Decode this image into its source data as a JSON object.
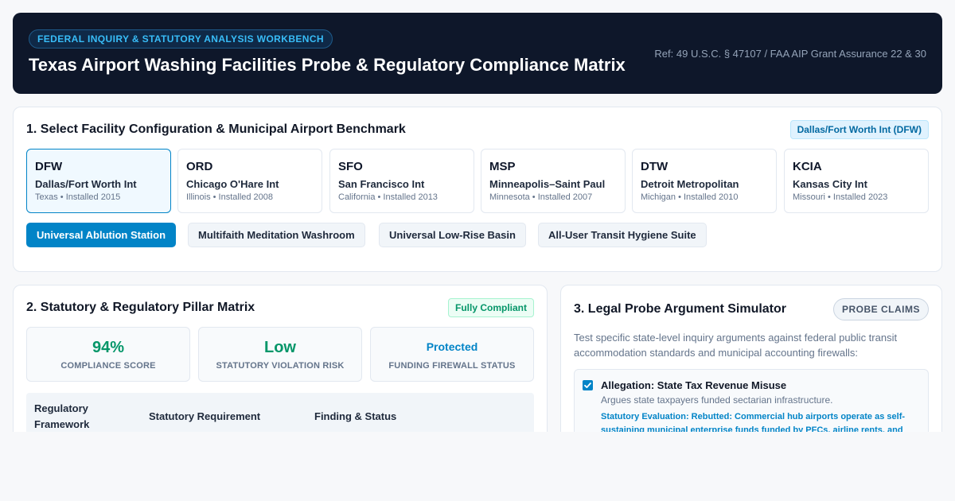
{
  "header": {
    "badge": "FEDERAL INQUIRY & STATUTORY ANALYSIS WORKBENCH",
    "title": "Texas Airport Washing Facilities Probe & Regulatory Compliance Matrix",
    "reference": "Ref: 49 U.S.C. § 47107 / FAA AIP Grant Assurance 22 & 30"
  },
  "section1": {
    "title": "1. Select Facility Configuration & Municipal Airport Benchmark",
    "selected": "Dallas/Fort Worth Int (DFW)",
    "airports": [
      {
        "code": "DFW",
        "name": "Dallas/Fort Worth Int",
        "meta": "Texas • Installed 2015",
        "active": true
      },
      {
        "code": "ORD",
        "name": "Chicago O'Hare Int",
        "meta": "Illinois • Installed 2008",
        "active": false
      },
      {
        "code": "SFO",
        "name": "San Francisco Int",
        "meta": "California • Installed 2013",
        "active": false
      },
      {
        "code": "MSP",
        "name": "Minneapolis–Saint Paul",
        "meta": "Minnesota • Installed 2007",
        "active": false
      },
      {
        "code": "DTW",
        "name": "Detroit Metropolitan",
        "meta": "Michigan • Installed 2010",
        "active": false
      },
      {
        "code": "KCIA",
        "name": "Kansas City Int",
        "meta": "Missouri • Installed 2023",
        "active": false
      }
    ],
    "configs": [
      {
        "label": "Universal Ablution Station",
        "active": true
      },
      {
        "label": "Multifaith Meditation Washroom",
        "active": false
      },
      {
        "label": "Universal Low-Rise Basin",
        "active": false
      },
      {
        "label": "All-User Transit Hygiene Suite",
        "active": false
      }
    ]
  },
  "section2": {
    "title": "2. Statutory & Regulatory Pillar Matrix",
    "status": "Fully Compliant",
    "metrics": [
      {
        "value": "94%",
        "label": "COMPLIANCE SCORE"
      },
      {
        "value": "Low",
        "label": "STATUTORY VIOLATION RISK"
      },
      {
        "value": "Protected",
        "label": "FUNDING FIREWALL STATUS"
      }
    ],
    "table_headers": [
      "Regulatory Framework",
      "Statutory Requirement",
      "Finding & Status"
    ]
  },
  "section3": {
    "title": "3. Legal Probe Argument Simulator",
    "probe_button": "PROBE CLAIMS",
    "description": "Test specific state-level inquiry arguments against federal public transit accommodation standards and municipal accounting firewalls:",
    "claims": [
      {
        "title": "Allegation: State Tax Revenue Misuse",
        "description": "Argues state taxpayers funded sectarian infrastructure.",
        "evaluation": "Statutory Evaluation: Rebutted: Commercial hub airports operate as self-sustaining municipal enterprise funds funded by PFCs, airline rents, and",
        "checked": true
      }
    ]
  },
  "colors": {
    "accent": "#0284c7",
    "header_bg": "#0e172a",
    "success": "#059669"
  }
}
